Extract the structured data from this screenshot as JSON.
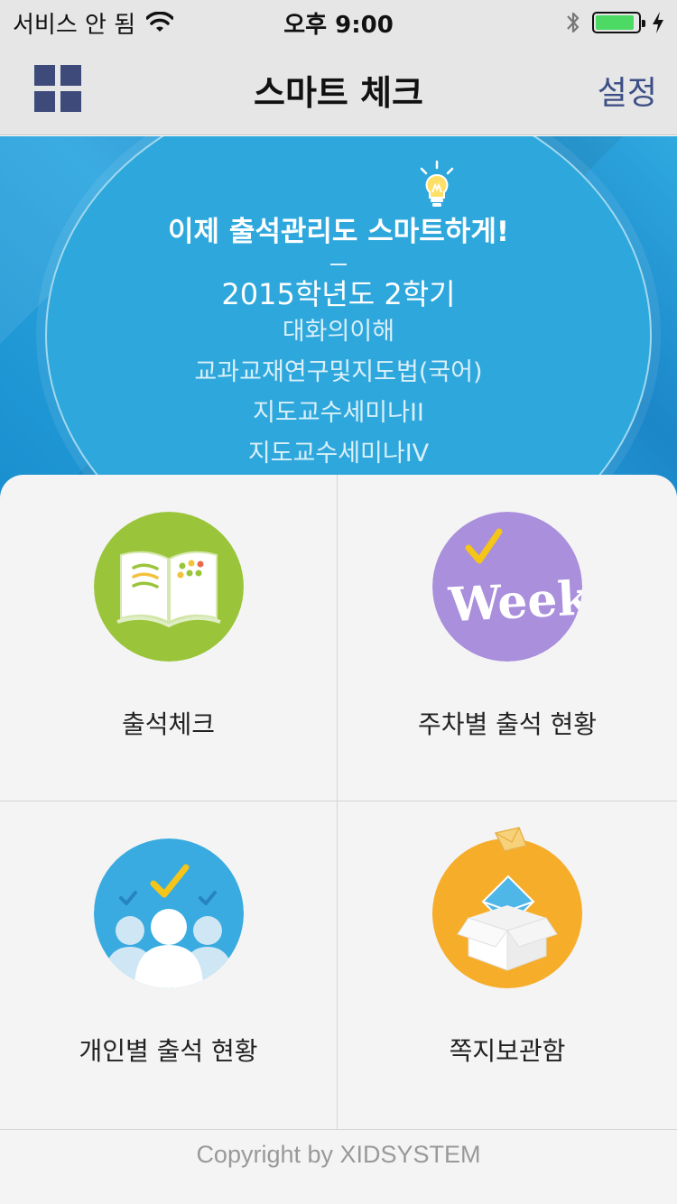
{
  "status_bar": {
    "carrier": "서비스 안 됨",
    "time": "오후 9:00",
    "battery_level": 0.92
  },
  "nav": {
    "title": "스마트 체크",
    "settings_label": "설정"
  },
  "banner": {
    "headline": "이제 출석관리도 스마트하게!",
    "term": "2015학년도 2학기",
    "courses": [
      "대화의이해",
      "교과교재연구및지도법(국어)",
      "지도교수세미나II",
      "지도교수세미나IV"
    ]
  },
  "menu": {
    "items": [
      {
        "label": "출석체크",
        "icon": "open-book-icon",
        "color": "#9ac53a"
      },
      {
        "label": "주차별 출석 현황",
        "icon": "week-check-icon",
        "color": "#a98fdc",
        "icon_text": "Week"
      },
      {
        "label": "개인별 출석 현황",
        "icon": "people-check-icon",
        "color": "#39abe0"
      },
      {
        "label": "쪽지보관함",
        "icon": "message-box-icon",
        "color": "#f6ad2a"
      }
    ]
  },
  "footer": {
    "copyright": "Copyright by XIDSYSTEM"
  },
  "colors": {
    "nav_bg": "#e6e6e6",
    "accent": "#3d4f86",
    "banner_blue": "#2ea8dc",
    "battery_green": "#4cd964"
  }
}
